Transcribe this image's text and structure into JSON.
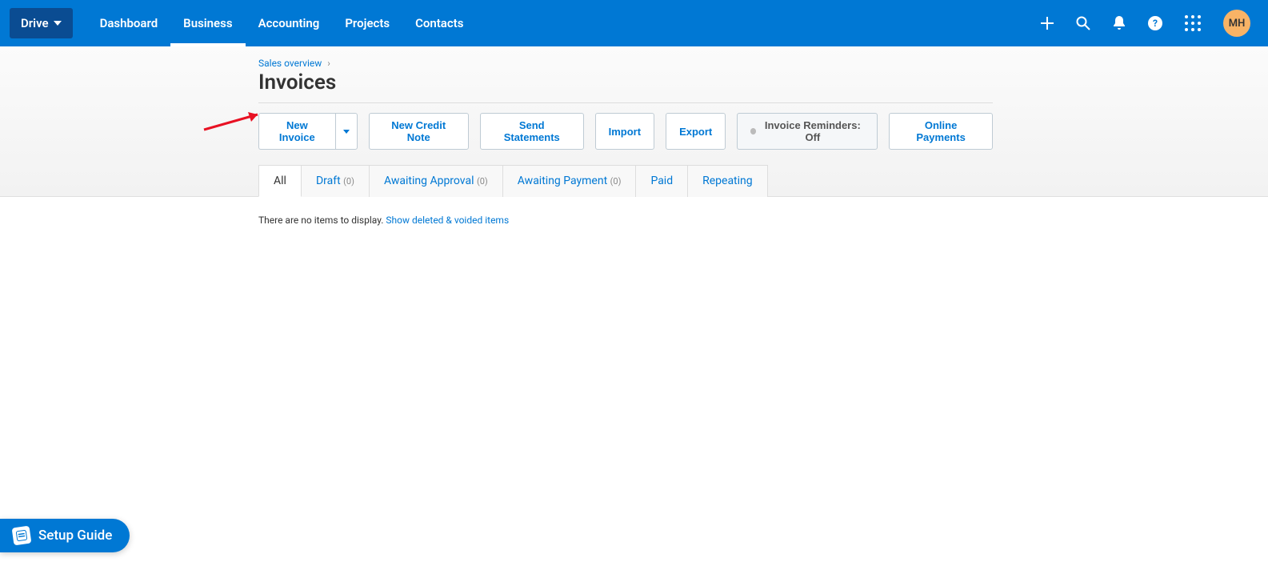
{
  "header": {
    "org": "Drive",
    "nav": {
      "dashboard": "Dashboard",
      "business": "Business",
      "accounting": "Accounting",
      "projects": "Projects",
      "contacts": "Contacts"
    },
    "avatar": "MH"
  },
  "breadcrumb": {
    "parent": "Sales overview",
    "sep": "›"
  },
  "page": {
    "title": "Invoices"
  },
  "actions": {
    "new_invoice": "New Invoice",
    "new_credit_note": "New Credit Note",
    "send_statements": "Send Statements",
    "import": "Import",
    "export": "Export",
    "invoice_reminders": "Invoice Reminders: Off",
    "online_payments": "Online Payments"
  },
  "tabs": {
    "all": "All",
    "draft": {
      "label": "Draft",
      "count": "(0)"
    },
    "awaiting_approval": {
      "label": "Awaiting Approval",
      "count": "(0)"
    },
    "awaiting_payment": {
      "label": "Awaiting Payment",
      "count": "(0)"
    },
    "paid": "Paid",
    "repeating": "Repeating"
  },
  "empty": {
    "text": "There are no items to display. ",
    "link": "Show deleted & voided items"
  },
  "setup_guide": "Setup Guide"
}
